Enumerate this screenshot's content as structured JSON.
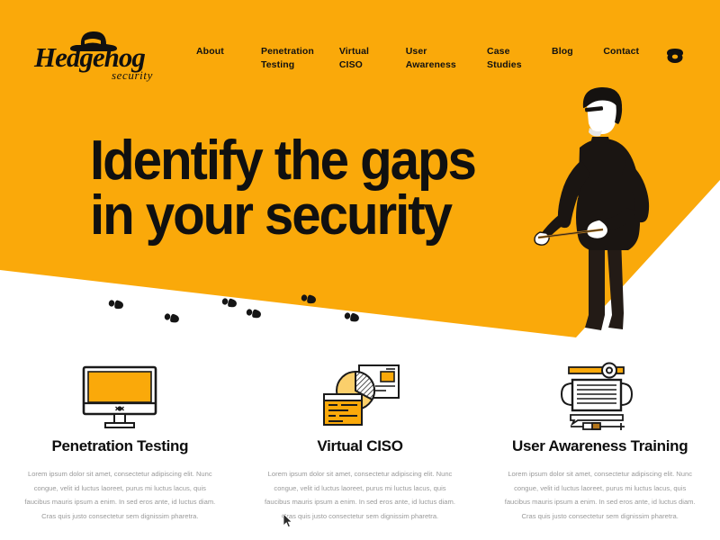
{
  "brand": {
    "name": "Hedgehog",
    "tagline": "security",
    "logo_icon": "fedora-hat-icon",
    "accent_color": "#FAA90A",
    "dark_color": "#101010"
  },
  "nav": {
    "items": [
      {
        "label": "About",
        "key": "about"
      },
      {
        "label": "Penetration\nTesting",
        "key": "penetration-testing"
      },
      {
        "label": "Virtual\nCISO",
        "key": "virtual-ciso"
      },
      {
        "label": "User\nAwareness",
        "key": "user-awareness"
      },
      {
        "label": "Case\nStudies",
        "key": "case-studies"
      },
      {
        "label": "Blog",
        "key": "blog"
      },
      {
        "label": "Contact",
        "key": "contact"
      }
    ],
    "phone_icon": "telephone-icon"
  },
  "hero": {
    "headline_line1": "Identify the gaps",
    "headline_line2": "in your security",
    "illustration": "man-with-measuring-tape",
    "footprints_icon": "footprint-trail-icon",
    "footprint_count": 6
  },
  "features": [
    {
      "icon": "desktop-monitor-icon",
      "title": "Penetration Testing",
      "body": "Lorem ipsum dolor sit amet, consectetur adipiscing elit. Nunc congue, velit id luctus laoreet, purus mi luctus lacus, quis faucibus mauris ipsum a enim. In sed eros ante, id luctus diam. Cras quis justo consectetur sem dignissim pharetra."
    },
    {
      "icon": "pie-chart-report-icon",
      "title": "Virtual CISO",
      "body": "Lorem ipsum dolor sit amet, consectetur adipiscing elit. Nunc congue, velit id luctus laoreet, purus mi luctus lacus, quis faucibus mauris ipsum a enim. In sed eros ante, id luctus diam. Cras quis justo consectetur sem dignissim pharetra."
    },
    {
      "icon": "presentation-board-icon",
      "title": "User Awareness Training",
      "body": "Lorem ipsum dolor sit amet, consectetur adipiscing elit. Nunc congue, velit id luctus laoreet, purus mi luctus lacus, quis faucibus mauris ipsum a enim. In sed eros ante, id luctus diam. Cras quis justo consectetur sem dignissim pharetra."
    }
  ],
  "pointer": {
    "icon": "mouse-cursor-icon"
  }
}
